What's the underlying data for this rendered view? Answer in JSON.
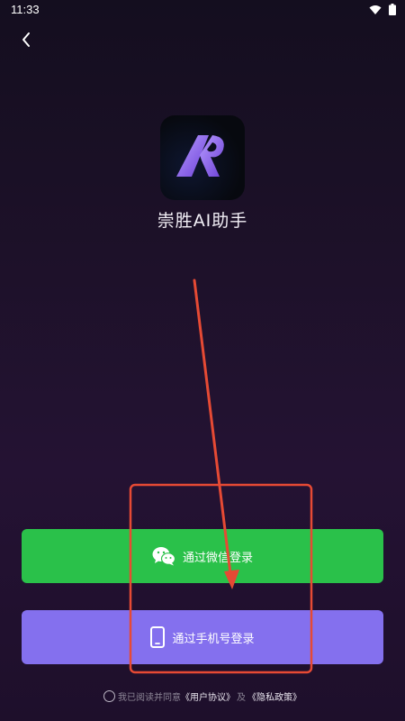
{
  "status_bar": {
    "time": "11:33"
  },
  "app": {
    "name": "崇胜AI助手"
  },
  "buttons": {
    "wechat_login": "通过微信登录",
    "phone_login": "通过手机号登录"
  },
  "agreement": {
    "prefix": "我已阅读并同意",
    "user_agreement": "《用户协议》",
    "conjunction": "及",
    "privacy_policy": "《隐私政策》"
  },
  "colors": {
    "wechat_green": "#2ac14a",
    "phone_purple": "#8470ee",
    "annotation_red": "#e64a34"
  }
}
